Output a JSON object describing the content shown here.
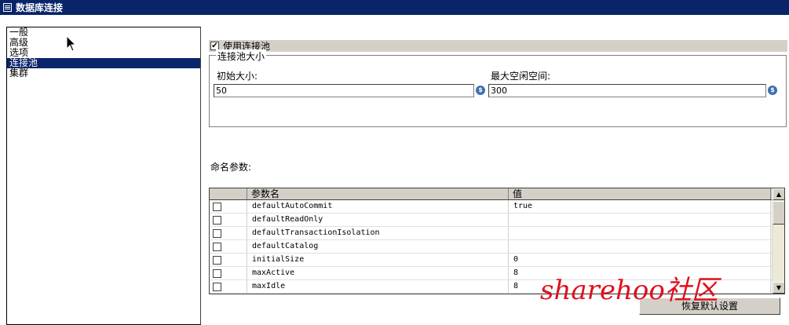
{
  "window": {
    "title": "数据库连接"
  },
  "sidebar": {
    "items": [
      {
        "label": "一般",
        "selected": false
      },
      {
        "label": "高级",
        "selected": false
      },
      {
        "label": "选项",
        "selected": false
      },
      {
        "label": "连接池",
        "selected": true
      },
      {
        "label": "集群",
        "selected": false
      }
    ]
  },
  "pool": {
    "use_pool_label": "使用连接池",
    "use_pool_checked": true,
    "group_label": "连接池大小",
    "initial_size_label": "初始大小:",
    "initial_size_value": "50",
    "max_idle_label": "最大空闲空间:",
    "max_idle_value": "300"
  },
  "params": {
    "label": "命名参数:",
    "columns": [
      "",
      "参数名",
      "值"
    ],
    "rows": [
      {
        "name": "defaultAutoCommit",
        "value": "true"
      },
      {
        "name": "defaultReadOnly",
        "value": ""
      },
      {
        "name": "defaultTransactionIsolation",
        "value": ""
      },
      {
        "name": "defaultCatalog",
        "value": ""
      },
      {
        "name": "initialSize",
        "value": "0"
      },
      {
        "name": "maxActive",
        "value": "8"
      },
      {
        "name": "maxIdle",
        "value": "8"
      }
    ]
  },
  "buttons": {
    "restore_defaults": "恢复默认设置"
  },
  "watermark": "sharehoo社区",
  "colors": {
    "titlebar": "#0a246a",
    "selection": "#0a246a",
    "watermark": "#e0101c",
    "panel": "#d4d0c8"
  }
}
